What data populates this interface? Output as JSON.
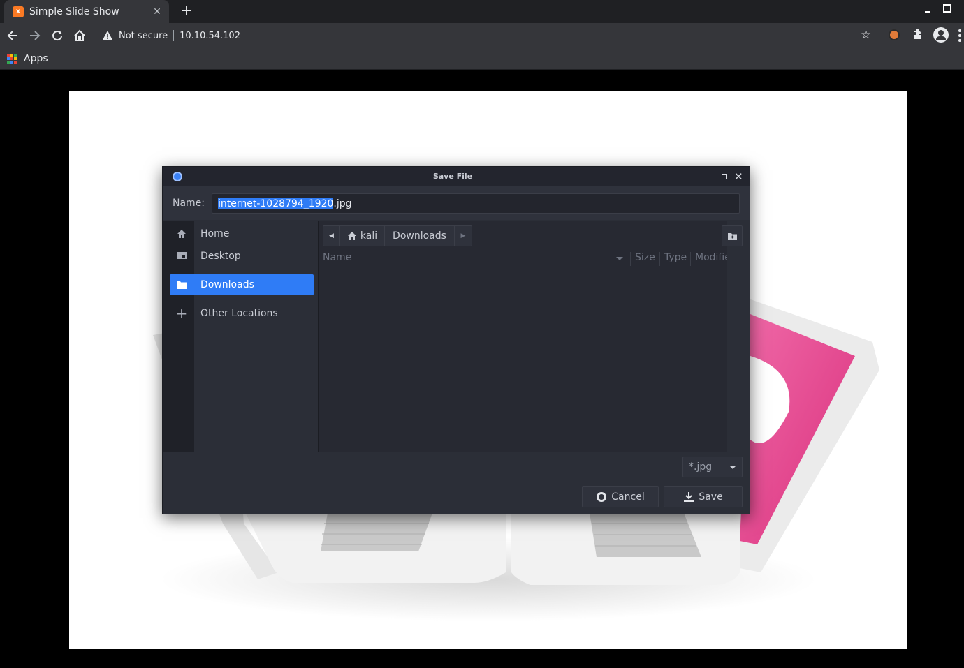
{
  "browser": {
    "tab_title": "Simple Slide Show",
    "favicon_text": "x",
    "new_tab_label": "+",
    "security_label": "Not secure",
    "url": "10.10.54.102",
    "bookmarks": [
      {
        "label": "Apps",
        "icon": "apps-grid-icon"
      }
    ]
  },
  "dialog": {
    "title": "Save File",
    "name_label": "Name:",
    "name_value_selected": "internet-1028794_1920",
    "name_value_ext": ".jpg",
    "places": [
      {
        "label": "Home",
        "icon": "home-icon"
      },
      {
        "label": "Desktop",
        "icon": "desktop-icon"
      },
      {
        "label": "Downloads",
        "icon": "folder-icon",
        "active": true
      },
      {
        "label": "Other Locations",
        "icon": "plus-icon"
      }
    ],
    "path": {
      "back": "◀",
      "segment1": "kali",
      "segment2": "Downloads",
      "forward": "▶"
    },
    "columns": {
      "name": "Name",
      "size": "Size",
      "type": "Type",
      "modified": "Modifie"
    },
    "filter_value": "*.jpg",
    "cancel_label": "Cancel",
    "save_label": "Save"
  },
  "colors": {
    "accent": "#2f7cf6",
    "dialog_bg": "#2b2e37",
    "slide_pink": "#e8448f"
  }
}
